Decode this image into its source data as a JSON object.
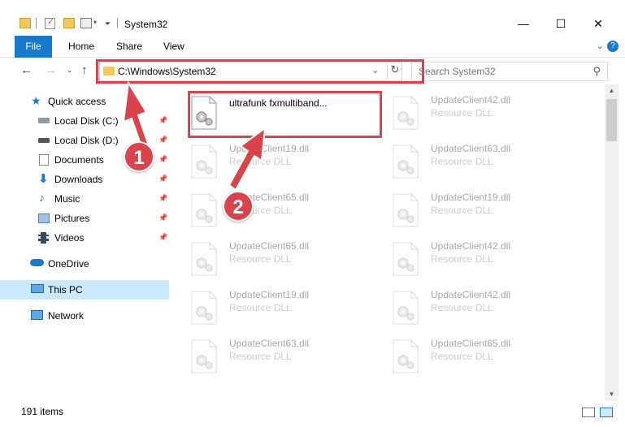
{
  "window": {
    "title": "System32",
    "controls": {
      "minimize": "—",
      "maximize": "☐",
      "close": "✕"
    }
  },
  "ribbon": {
    "tabs": [
      "File",
      "Home",
      "Share",
      "View"
    ]
  },
  "navigation": {
    "address": "C:\\Windows\\System32",
    "search_placeholder": "Search System32"
  },
  "sidebar": {
    "items": [
      {
        "label": "Quick access",
        "icon": "star-icon",
        "pinned": false
      },
      {
        "label": "Local Disk (C:)",
        "icon": "drive-icon",
        "pinned": true
      },
      {
        "label": "Local Disk (D:)",
        "icon": "drive-icon",
        "pinned": true
      },
      {
        "label": "Documents",
        "icon": "documents-icon",
        "pinned": true
      },
      {
        "label": "Downloads",
        "icon": "download-icon",
        "pinned": true
      },
      {
        "label": "Music",
        "icon": "music-icon",
        "pinned": true
      },
      {
        "label": "Pictures",
        "icon": "pictures-icon",
        "pinned": true
      },
      {
        "label": "Videos",
        "icon": "videos-icon",
        "pinned": true
      },
      {
        "label": "OneDrive",
        "icon": "cloud-icon",
        "pinned": false
      },
      {
        "label": "This PC",
        "icon": "pc-icon",
        "pinned": false,
        "selected": true
      },
      {
        "label": "Network",
        "icon": "network-icon",
        "pinned": false
      }
    ]
  },
  "files": {
    "column_left": [
      {
        "name": "ultrafunk fxmultiband...",
        "type": ""
      },
      {
        "name": "UpdateClient19.dll",
        "type": "Resource DLL"
      },
      {
        "name": "UpdateClient65.dll",
        "type": "Resource DLL"
      },
      {
        "name": "UpdateClient65.dll",
        "type": "Resource DLL"
      },
      {
        "name": "UpdateClient19.dll",
        "type": "Resource DLL"
      },
      {
        "name": "UpdateClient63.dll",
        "type": "Resource DLL"
      }
    ],
    "column_right": [
      {
        "name": "UpdateClient42.dll",
        "type": "Resource DLL"
      },
      {
        "name": "UpdateClient63.dll",
        "type": "Resource DLL"
      },
      {
        "name": "UpdateClient19.dll",
        "type": "Resource DLL"
      },
      {
        "name": "UpdateClient42.dll",
        "type": "Resource DLL"
      },
      {
        "name": "UpdateClient42.dll",
        "type": "Resource DLL"
      },
      {
        "name": "UpdateClient65.dll",
        "type": "Resource DLL"
      }
    ]
  },
  "status": {
    "item_count": "191 items"
  },
  "annotations": {
    "callout_1": "1",
    "callout_2": "2",
    "color": "#d9434b"
  },
  "colors": {
    "accent": "#1979ca",
    "selection": "#cce8ff",
    "folder": "#f0c75e"
  }
}
